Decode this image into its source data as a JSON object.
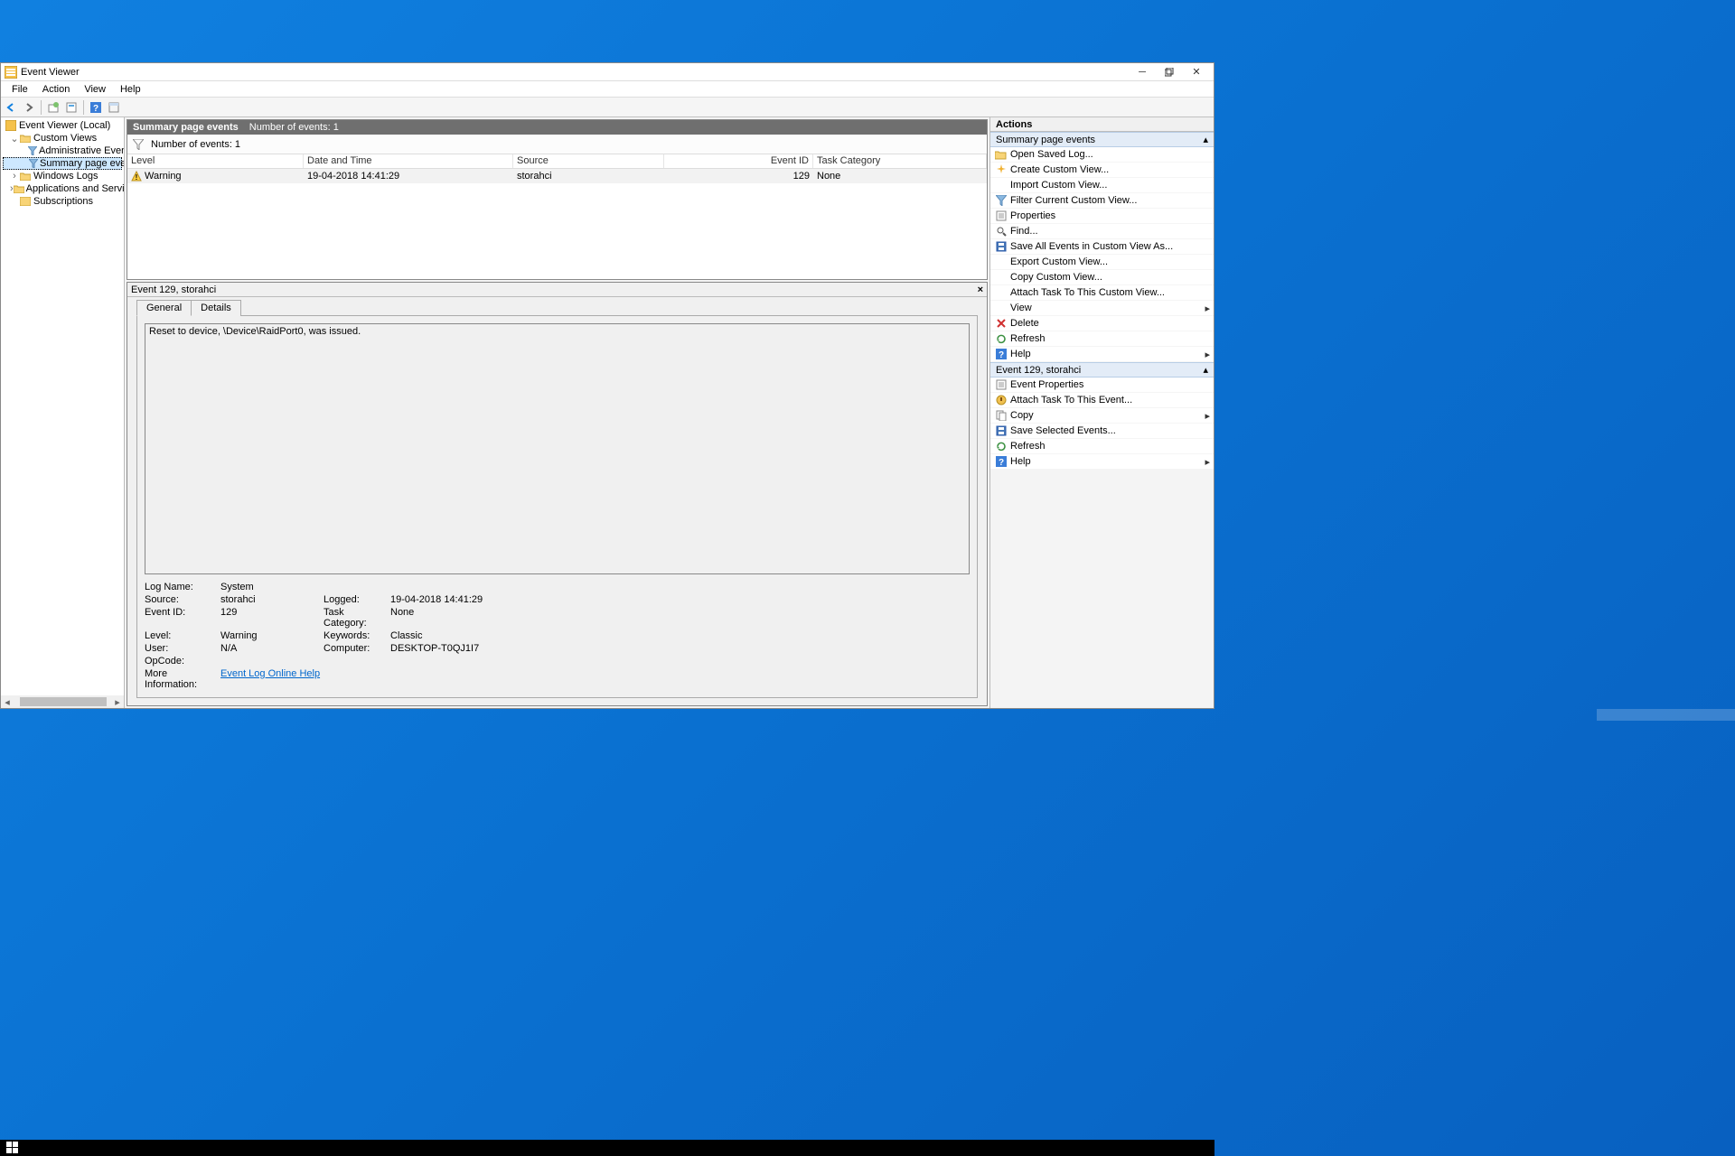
{
  "window": {
    "title": "Event Viewer",
    "menus": [
      "File",
      "Action",
      "View",
      "Help"
    ]
  },
  "tree": {
    "root": "Event Viewer (Local)",
    "items": [
      {
        "label": "Custom Views",
        "expanded": true,
        "indent": 1
      },
      {
        "label": "Administrative Events",
        "indent": 2,
        "type": "filter"
      },
      {
        "label": "Summary page events",
        "indent": 2,
        "type": "filter",
        "selected": true
      },
      {
        "label": "Windows Logs",
        "indent": 1,
        "expandable": true
      },
      {
        "label": "Applications and Services Lo",
        "indent": 1,
        "expandable": true
      },
      {
        "label": "Subscriptions",
        "indent": 1
      }
    ]
  },
  "events": {
    "header_title": "Summary page events",
    "header_count": "Number of events: 1",
    "filter_text": "Number of events: 1",
    "columns": [
      "Level",
      "Date and Time",
      "Source",
      "Event ID",
      "Task Category"
    ],
    "rows": [
      {
        "level": "Warning",
        "datetime": "19-04-2018 14:41:29",
        "source": "storahci",
        "event_id": "129",
        "task": "None"
      }
    ]
  },
  "detail": {
    "title": "Event 129, storahci",
    "tabs": [
      "General",
      "Details"
    ],
    "message": "Reset to device, \\Device\\RaidPort0, was issued.",
    "props": {
      "log_name_lbl": "Log Name:",
      "log_name": "System",
      "source_lbl": "Source:",
      "source": "storahci",
      "logged_lbl": "Logged:",
      "logged": "19-04-2018 14:41:29",
      "event_id_lbl": "Event ID:",
      "event_id": "129",
      "task_cat_lbl": "Task Category:",
      "task_cat": "None",
      "level_lbl": "Level:",
      "level": "Warning",
      "keywords_lbl": "Keywords:",
      "keywords": "Classic",
      "user_lbl": "User:",
      "user": "N/A",
      "computer_lbl": "Computer:",
      "computer": "DESKTOP-T0QJ1I7",
      "opcode_lbl": "OpCode:",
      "more_info_lbl": "More Information:",
      "more_info_link": "Event Log Online Help"
    }
  },
  "actions": {
    "pane_title": "Actions",
    "section1": "Summary page events",
    "items1": [
      {
        "label": "Open Saved Log...",
        "icon": "folder-open-icon"
      },
      {
        "label": "Create Custom View...",
        "icon": "sparkle-icon"
      },
      {
        "label": "Import Custom View...",
        "icon": ""
      },
      {
        "label": "Filter Current Custom View...",
        "icon": "filter-icon"
      },
      {
        "label": "Properties",
        "icon": "properties-icon"
      },
      {
        "label": "Find...",
        "icon": "search-icon"
      },
      {
        "label": "Save All Events in Custom View As...",
        "icon": "save-icon"
      },
      {
        "label": "Export Custom View...",
        "icon": ""
      },
      {
        "label": "Copy Custom View...",
        "icon": ""
      },
      {
        "label": "Attach Task To This Custom View...",
        "icon": ""
      },
      {
        "label": "View",
        "icon": "",
        "submenu": true
      },
      {
        "label": "Delete",
        "icon": "delete-icon"
      },
      {
        "label": "Refresh",
        "icon": "refresh-icon"
      },
      {
        "label": "Help",
        "icon": "help-icon",
        "submenu": true
      }
    ],
    "section2": "Event 129, storahci",
    "items2": [
      {
        "label": "Event Properties",
        "icon": "properties-icon"
      },
      {
        "label": "Attach Task To This Event...",
        "icon": "task-icon"
      },
      {
        "label": "Copy",
        "icon": "copy-icon",
        "submenu": true
      },
      {
        "label": "Save Selected Events...",
        "icon": "save-icon"
      },
      {
        "label": "Refresh",
        "icon": "refresh-icon"
      },
      {
        "label": "Help",
        "icon": "help-icon",
        "submenu": true
      }
    ]
  }
}
